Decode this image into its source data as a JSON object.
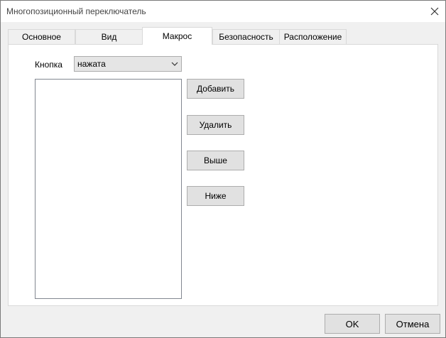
{
  "window": {
    "title": "Многопозиционный переключатель"
  },
  "tabs": [
    {
      "label": "Основное"
    },
    {
      "label": "Вид"
    },
    {
      "label": "Макрос",
      "active": true
    },
    {
      "label": "Безопасность"
    },
    {
      "label": "Расположение"
    }
  ],
  "macro": {
    "button_label": "Кнопка",
    "button_select_value": "нажата",
    "actions": {
      "add": "Добавить",
      "remove": "Удалить",
      "up": "Выше",
      "down": "Ниже"
    }
  },
  "footer": {
    "ok": "OK",
    "cancel": "Отмена"
  },
  "icons": {
    "close": "close-icon",
    "dropdown": "chevron-down-icon"
  }
}
